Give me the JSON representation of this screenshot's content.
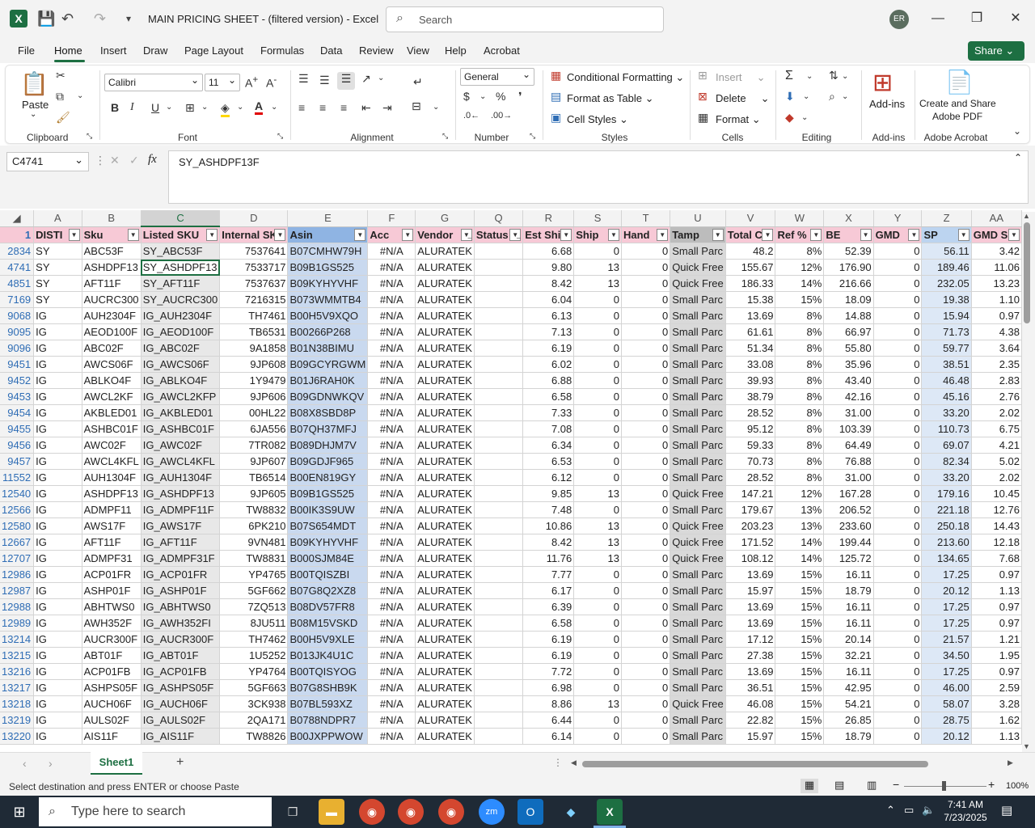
{
  "window": {
    "title": "MAIN PRICING SHEET - (filtered version)  -  Excel",
    "search_placeholder": "Search",
    "user_initials": "ER"
  },
  "menu": {
    "items": [
      "File",
      "Home",
      "Insert",
      "Draw",
      "Page Layout",
      "Formulas",
      "Data",
      "Review",
      "View",
      "Help",
      "Acrobat"
    ],
    "share_label": "Share"
  },
  "ribbon": {
    "clipboard": {
      "label": "Clipboard",
      "paste": "Paste"
    },
    "font": {
      "label": "Font",
      "font_name": "Calibri",
      "font_size": "11"
    },
    "alignment": {
      "label": "Alignment"
    },
    "number": {
      "label": "Number",
      "format": "General"
    },
    "styles": {
      "label": "Styles",
      "conditional": "Conditional Formatting",
      "format_table": "Format as Table",
      "cell_styles": "Cell Styles"
    },
    "cells": {
      "label": "Cells",
      "insert": "Insert",
      "delete": "Delete",
      "format": "Format"
    },
    "editing": {
      "label": "Editing"
    },
    "addins": {
      "label": "Add-ins",
      "button": "Add-ins"
    },
    "acrobat": {
      "label": "Adobe Acrobat",
      "button_line1": "Create and Share",
      "button_line2": "Adobe PDF"
    }
  },
  "formula_bar": {
    "name_box": "C4741",
    "formula": "SY_ASHDPF13F"
  },
  "grid": {
    "columns": [
      "A",
      "B",
      "C",
      "D",
      "E",
      "F",
      "G",
      "Q",
      "R",
      "S",
      "T",
      "U",
      "V",
      "W",
      "X",
      "Y",
      "Z",
      "AA"
    ],
    "header_row_number": "1",
    "headers": [
      "DISTI",
      "Sku",
      "Listed SKU",
      "Internal SK",
      "Asin",
      "Acc",
      "Vendor",
      "Status",
      "Est Ship",
      "Ship",
      "Hand",
      "Tamp",
      "Total C",
      "Ref %",
      "BE",
      "GMD",
      "SP",
      "GMD SI"
    ],
    "rows": [
      [
        "2834",
        "SY",
        "ABC53F",
        "SY_ABC53F",
        "7537641",
        "B07CMHW79H",
        "#N/A",
        "ALURATEK",
        "",
        "6.68",
        "0",
        "0",
        "Small Parc",
        "48.2",
        "8%",
        "52.39",
        "0",
        "56.11",
        "3.42"
      ],
      [
        "4741",
        "SY",
        "ASHDPF13",
        "SY_ASHDPF13",
        "7533717",
        "B09B1GS525",
        "#N/A",
        "ALURATEK",
        "",
        "9.80",
        "13",
        "0",
        "Quick Free",
        "155.67",
        "12%",
        "176.90",
        "0",
        "189.46",
        "11.06"
      ],
      [
        "4851",
        "SY",
        "AFT11F",
        "SY_AFT11F",
        "7537637",
        "B09KYHYVHF",
        "#N/A",
        "ALURATEK",
        "",
        "8.42",
        "13",
        "0",
        "Quick Free",
        "186.33",
        "14%",
        "216.66",
        "0",
        "232.05",
        "13.23"
      ],
      [
        "7169",
        "SY",
        "AUCRC300",
        "SY_AUCRC300",
        "7216315",
        "B073WMMTB4",
        "#N/A",
        "ALURATEK",
        "",
        "6.04",
        "0",
        "0",
        "Small Parc",
        "15.38",
        "15%",
        "18.09",
        "0",
        "19.38",
        "1.10"
      ],
      [
        "9068",
        "IG",
        "AUH2304F",
        "IG_AUH2304F",
        "TH7461",
        "B00H5V9XQO",
        "#N/A",
        "ALURATEK",
        "",
        "6.13",
        "0",
        "0",
        "Small Parc",
        "13.69",
        "8%",
        "14.88",
        "0",
        "15.94",
        "0.97"
      ],
      [
        "9095",
        "IG",
        "AEOD100F",
        "IG_AEOD100F",
        "TB6531",
        "B00266P268",
        "#N/A",
        "ALURATEK",
        "",
        "7.13",
        "0",
        "0",
        "Small Parc",
        "61.61",
        "8%",
        "66.97",
        "0",
        "71.73",
        "4.38"
      ],
      [
        "9096",
        "IG",
        "ABC02F",
        "IG_ABC02F",
        "9A1858",
        "B01N38BIMU",
        "#N/A",
        "ALURATEK",
        "",
        "6.19",
        "0",
        "0",
        "Small Parc",
        "51.34",
        "8%",
        "55.80",
        "0",
        "59.77",
        "3.64"
      ],
      [
        "9451",
        "IG",
        "AWCS06F",
        "IG_AWCS06F",
        "9JP608",
        "B09GCYRGWM",
        "#N/A",
        "ALURATEK",
        "",
        "6.02",
        "0",
        "0",
        "Small Parc",
        "33.08",
        "8%",
        "35.96",
        "0",
        "38.51",
        "2.35"
      ],
      [
        "9452",
        "IG",
        "ABLKO4F",
        "IG_ABLKO4F",
        "1Y9479",
        "B01J6RAH0K",
        "#N/A",
        "ALURATEK",
        "",
        "6.88",
        "0",
        "0",
        "Small Parc",
        "39.93",
        "8%",
        "43.40",
        "0",
        "46.48",
        "2.83"
      ],
      [
        "9453",
        "IG",
        "AWCL2KF",
        "IG_AWCL2KFP",
        "9JP606",
        "B09GDNWKQV",
        "#N/A",
        "ALURATEK",
        "",
        "6.58",
        "0",
        "0",
        "Small Parc",
        "38.79",
        "8%",
        "42.16",
        "0",
        "45.16",
        "2.76"
      ],
      [
        "9454",
        "IG",
        "AKBLED01",
        "IG_AKBLED01",
        "00HL22",
        "B08X8SBD8P",
        "#N/A",
        "ALURATEK",
        "",
        "7.33",
        "0",
        "0",
        "Small Parc",
        "28.52",
        "8%",
        "31.00",
        "0",
        "33.20",
        "2.02"
      ],
      [
        "9455",
        "IG",
        "ASHBC01F",
        "IG_ASHBC01F",
        "6JA556",
        "B07QH37MFJ",
        "#N/A",
        "ALURATEK",
        "",
        "7.08",
        "0",
        "0",
        "Small Parc",
        "95.12",
        "8%",
        "103.39",
        "0",
        "110.73",
        "6.75"
      ],
      [
        "9456",
        "IG",
        "AWC02F",
        "IG_AWC02F",
        "7TR082",
        "B089DHJM7V",
        "#N/A",
        "ALURATEK",
        "",
        "6.34",
        "0",
        "0",
        "Small Parc",
        "59.33",
        "8%",
        "64.49",
        "0",
        "69.07",
        "4.21"
      ],
      [
        "9457",
        "IG",
        "AWCL4KFL",
        "IG_AWCL4KFL",
        "9JP607",
        "B09GDJF965",
        "#N/A",
        "ALURATEK",
        "",
        "6.53",
        "0",
        "0",
        "Small Parc",
        "70.73",
        "8%",
        "76.88",
        "0",
        "82.34",
        "5.02"
      ],
      [
        "11552",
        "IG",
        "AUH1304F",
        "IG_AUH1304F",
        "TB6514",
        "B00EN819GY",
        "#N/A",
        "ALURATEK",
        "",
        "6.12",
        "0",
        "0",
        "Small Parc",
        "28.52",
        "8%",
        "31.00",
        "0",
        "33.20",
        "2.02"
      ],
      [
        "12540",
        "IG",
        "ASHDPF13",
        "IG_ASHDPF13",
        "9JP605",
        "B09B1GS525",
        "#N/A",
        "ALURATEK",
        "",
        "9.85",
        "13",
        "0",
        "Quick Free",
        "147.21",
        "12%",
        "167.28",
        "0",
        "179.16",
        "10.45"
      ],
      [
        "12566",
        "IG",
        "ADMPF11",
        "IG_ADMPF11F",
        "TW8832",
        "B00IK3S9UW",
        "#N/A",
        "ALURATEK",
        "",
        "7.48",
        "0",
        "0",
        "Small Parc",
        "179.67",
        "13%",
        "206.52",
        "0",
        "221.18",
        "12.76"
      ],
      [
        "12580",
        "IG",
        "AWS17F",
        "IG_AWS17F",
        "6PK210",
        "B07S654MDT",
        "#N/A",
        "ALURATEK",
        "",
        "10.86",
        "13",
        "0",
        "Quick Free",
        "203.23",
        "13%",
        "233.60",
        "0",
        "250.18",
        "14.43"
      ],
      [
        "12667",
        "IG",
        "AFT11F",
        "IG_AFT11F",
        "9VN481",
        "B09KYHYVHF",
        "#N/A",
        "ALURATEK",
        "",
        "8.42",
        "13",
        "0",
        "Quick Free",
        "171.52",
        "14%",
        "199.44",
        "0",
        "213.60",
        "12.18"
      ],
      [
        "12707",
        "IG",
        "ADMPF31",
        "IG_ADMPF31F",
        "TW8831",
        "B000SJM84E",
        "#N/A",
        "ALURATEK",
        "",
        "11.76",
        "13",
        "0",
        "Quick Free",
        "108.12",
        "14%",
        "125.72",
        "0",
        "134.65",
        "7.68"
      ],
      [
        "12986",
        "IG",
        "ACP01FR",
        "IG_ACP01FR",
        "YP4765",
        "B00TQISZBI",
        "#N/A",
        "ALURATEK",
        "",
        "7.77",
        "0",
        "0",
        "Small Parc",
        "13.69",
        "15%",
        "16.11",
        "0",
        "17.25",
        "0.97"
      ],
      [
        "12987",
        "IG",
        "ASHP01F",
        "IG_ASHP01F",
        "5GF662",
        "B07G8Q2XZ8",
        "#N/A",
        "ALURATEK",
        "",
        "6.17",
        "0",
        "0",
        "Small Parc",
        "15.97",
        "15%",
        "18.79",
        "0",
        "20.12",
        "1.13"
      ],
      [
        "12988",
        "IG",
        "ABHTWS0",
        "IG_ABHTWS0",
        "7ZQ513",
        "B08DV57FR8",
        "#N/A",
        "ALURATEK",
        "",
        "6.39",
        "0",
        "0",
        "Small Parc",
        "13.69",
        "15%",
        "16.11",
        "0",
        "17.25",
        "0.97"
      ],
      [
        "12989",
        "IG",
        "AWH352F",
        "IG_AWH352FI",
        "8JU511",
        "B08M15VSKD",
        "#N/A",
        "ALURATEK",
        "",
        "6.58",
        "0",
        "0",
        "Small Parc",
        "13.69",
        "15%",
        "16.11",
        "0",
        "17.25",
        "0.97"
      ],
      [
        "13214",
        "IG",
        "AUCR300F",
        "IG_AUCR300F",
        "TH7462",
        "B00H5V9XLE",
        "#N/A",
        "ALURATEK",
        "",
        "6.19",
        "0",
        "0",
        "Small Parc",
        "17.12",
        "15%",
        "20.14",
        "0",
        "21.57",
        "1.21"
      ],
      [
        "13215",
        "IG",
        "ABT01F",
        "IG_ABT01F",
        "1U5252",
        "B013JK4U1C",
        "#N/A",
        "ALURATEK",
        "",
        "6.19",
        "0",
        "0",
        "Small Parc",
        "27.38",
        "15%",
        "32.21",
        "0",
        "34.50",
        "1.95"
      ],
      [
        "13216",
        "IG",
        "ACP01FB",
        "IG_ACP01FB",
        "YP4764",
        "B00TQISYOG",
        "#N/A",
        "ALURATEK",
        "",
        "7.72",
        "0",
        "0",
        "Small Parc",
        "13.69",
        "15%",
        "16.11",
        "0",
        "17.25",
        "0.97"
      ],
      [
        "13217",
        "IG",
        "ASHPS05F",
        "IG_ASHPS05F",
        "5GF663",
        "B07G8SHB9K",
        "#N/A",
        "ALURATEK",
        "",
        "6.98",
        "0",
        "0",
        "Small Parc",
        "36.51",
        "15%",
        "42.95",
        "0",
        "46.00",
        "2.59"
      ],
      [
        "13218",
        "IG",
        "AUCH06F",
        "IG_AUCH06F",
        "3CK938",
        "B07BL593XZ",
        "#N/A",
        "ALURATEK",
        "",
        "8.86",
        "13",
        "0",
        "Quick Free",
        "46.08",
        "15%",
        "54.21",
        "0",
        "58.07",
        "3.28"
      ],
      [
        "13219",
        "IG",
        "AULS02F",
        "IG_AULS02F",
        "2QA171",
        "B0788NDPR7",
        "#N/A",
        "ALURATEK",
        "",
        "6.44",
        "0",
        "0",
        "Small Parc",
        "22.82",
        "15%",
        "26.85",
        "0",
        "28.75",
        "1.62"
      ],
      [
        "13220",
        "IG",
        "AIS11F",
        "IG_AIS11F",
        "TW8826",
        "B00JXPPWOW",
        "#N/A",
        "ALURATEK",
        "",
        "6.14",
        "0",
        "0",
        "Small Parc",
        "15.97",
        "15%",
        "18.79",
        "0",
        "20.12",
        "1.13"
      ]
    ]
  },
  "sheets": {
    "active": "Sheet1"
  },
  "status": {
    "message": "Select destination and press ENTER or choose Paste",
    "zoom": "100%"
  },
  "taskbar": {
    "search_placeholder": "Type here to search",
    "time": "7:41 AM",
    "date": "7/23/2025"
  },
  "colors": {
    "excel_green": "#1d6f42",
    "header_pink": "#f7c9d6",
    "asin_blue": "#8fb4e3"
  }
}
